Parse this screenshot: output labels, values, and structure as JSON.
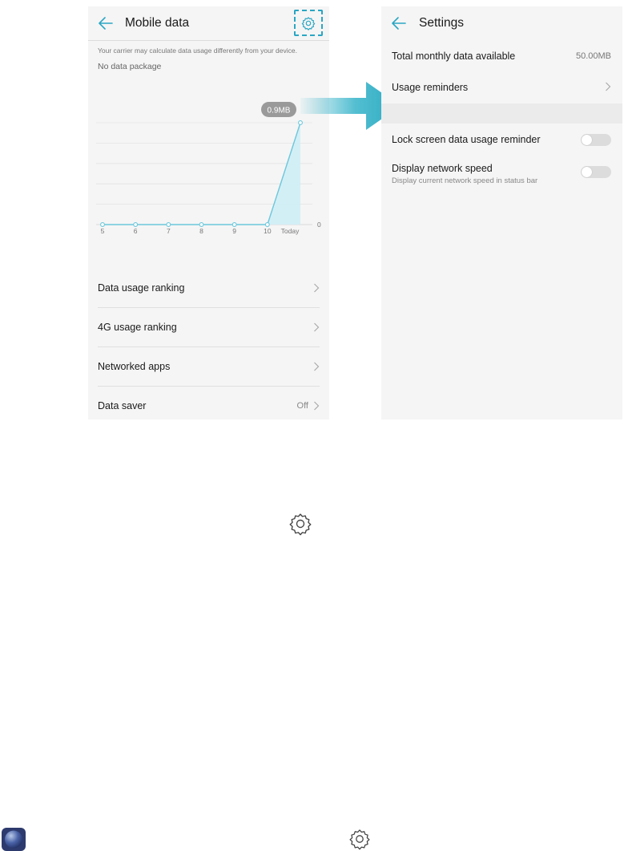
{
  "colors": {
    "accent": "#2ba6c3",
    "arrow": "#35b3c9",
    "chart_line": "#6cc7dc",
    "chart_fill": "#cfeef6"
  },
  "left_screen": {
    "title": "Mobile data",
    "back_icon": "back-arrow-icon",
    "settings_icon": "gear-icon",
    "carrier_note": "Your carrier may calculate data usage differently from your device.",
    "no_package": "No data package",
    "list": [
      {
        "label": "Data usage ranking",
        "value": ""
      },
      {
        "label": "4G usage ranking",
        "value": ""
      },
      {
        "label": "Networked apps",
        "value": ""
      },
      {
        "label": "Data saver",
        "value": "Off"
      }
    ]
  },
  "chart_data": {
    "type": "area",
    "categories": [
      "5",
      "6",
      "7",
      "8",
      "9",
      "10",
      "Today"
    ],
    "values": [
      0,
      0,
      0,
      0,
      0,
      0,
      0.9
    ],
    "callout": "0.9MB",
    "right_axis_label": "0",
    "grid": true
  },
  "right_screen": {
    "title": "Settings",
    "back_icon": "back-arrow-icon",
    "total_label": "Total monthly data available",
    "total_value": "50.00MB",
    "reminders_label": "Usage reminders",
    "lock_label": "Lock screen data usage reminder",
    "speed_label": "Display network speed",
    "speed_sub": "Display current network speed in status bar"
  },
  "icons": {
    "middle": "gear-icon",
    "bottom": "gear-icon",
    "app": "app-icon"
  }
}
